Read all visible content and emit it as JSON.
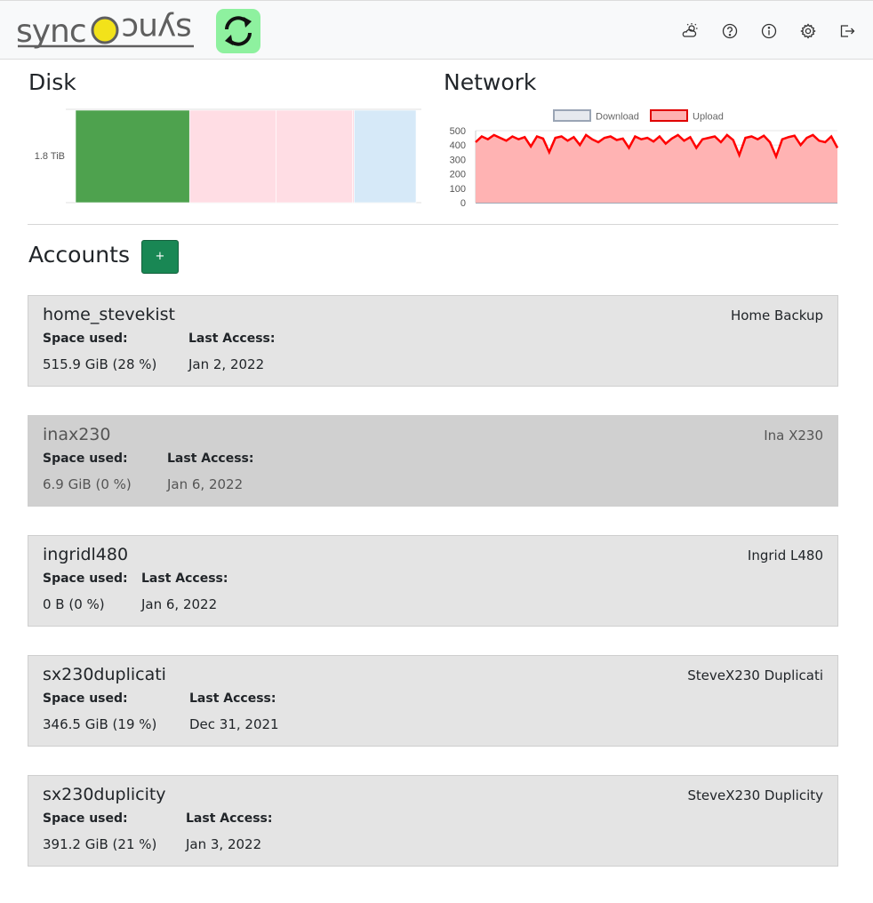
{
  "header": {
    "logo_text": "syncOsyns",
    "icons": [
      "weather-icon",
      "help-icon",
      "info-icon",
      "settings-icon",
      "logout-icon"
    ]
  },
  "disk": {
    "title": "Disk",
    "chart_data": {
      "type": "bar",
      "orientation": "horizontal-stacked",
      "categories": [
        "1.8 TiB"
      ],
      "series": [
        {
          "values": [
            515.9
          ],
          "color": "#4ea24e"
        },
        {
          "values": [
            391.2
          ],
          "color": "#ffdde4"
        },
        {
          "values": [
            346.5
          ],
          "color": "#ffdde4"
        },
        {
          "values": [
            6.9
          ],
          "color": "#ffdde4"
        },
        {
          "values": [
            0
          ],
          "color": "#ffdde4"
        },
        {
          "values": [
            280
          ],
          "color": "#d6e9f8"
        }
      ]
    }
  },
  "network": {
    "title": "Network",
    "chart_data": {
      "type": "area",
      "legend": [
        "Download",
        "Upload"
      ],
      "legend_position": "top",
      "ylim": [
        0,
        500
      ],
      "yticks": [
        "500",
        "400",
        "300",
        "200",
        "100",
        "0"
      ],
      "series": [
        {
          "name": "Download",
          "values": [
            0,
            0,
            0,
            0,
            0,
            0,
            0,
            0,
            0,
            0,
            0,
            0,
            0,
            0,
            0,
            0,
            0,
            0,
            0,
            0,
            0,
            0,
            0,
            0,
            0,
            0,
            0,
            0,
            0,
            0,
            0,
            0,
            0,
            0,
            0,
            0,
            0,
            0,
            0,
            0,
            0,
            0,
            0,
            0,
            0,
            0,
            0,
            0,
            0,
            0,
            0,
            0,
            0,
            0,
            0,
            0,
            0,
            0,
            0,
            0
          ],
          "color": "#dfe3ea"
        },
        {
          "name": "Upload",
          "values": [
            420,
            460,
            440,
            470,
            450,
            430,
            460,
            440,
            455,
            390,
            460,
            445,
            350,
            450,
            460,
            430,
            455,
            400,
            470,
            440,
            420,
            450,
            460,
            435,
            445,
            380,
            460,
            440,
            450,
            425,
            460,
            410,
            445,
            470,
            430,
            455,
            380,
            440,
            450,
            460,
            420,
            470,
            435,
            330,
            450,
            460,
            440,
            465,
            420,
            320,
            440,
            455,
            465,
            400,
            450,
            470,
            430,
            420,
            460,
            380
          ],
          "color": "#ff0000"
        }
      ]
    }
  },
  "accounts_section": {
    "title": "Accounts",
    "add_label": "+"
  },
  "accounts": [
    {
      "name": "home_stevekist",
      "description": "Home Backup",
      "space_label": "Space used:",
      "space": "515.9 GiB (28 %)",
      "access_label": "Last Access:",
      "access": "Jan 2, 2022"
    },
    {
      "name": "inax230",
      "description": "Ina X230",
      "space_label": "Space used:",
      "space": "6.9 GiB (0 %)",
      "access_label": "Last Access:",
      "access": "Jan 6, 2022"
    },
    {
      "name": "ingridl480",
      "description": "Ingrid L480",
      "space_label": "Space used:",
      "space": "0 B (0 %)",
      "access_label": "Last Access:",
      "access": "Jan 6, 2022"
    },
    {
      "name": "sx230duplicati",
      "description": "SteveX230 Duplicati",
      "space_label": "Space used:",
      "space": "346.5 GiB (19 %)",
      "access_label": "Last Access:",
      "access": "Dec 31, 2021"
    },
    {
      "name": "sx230duplicity",
      "description": "SteveX230 Duplicity",
      "space_label": "Space used:",
      "space": "391.2 GiB (21 %)",
      "access_label": "Last Access:",
      "access": "Jan 3, 2022"
    }
  ]
}
